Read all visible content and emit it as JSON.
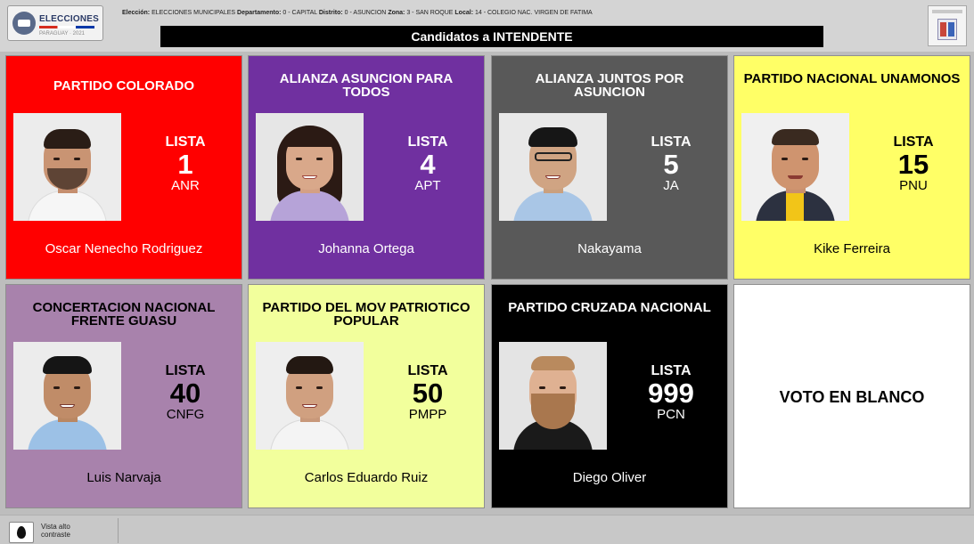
{
  "header": {
    "logo_title": "ELECCIONES",
    "logo_subtitle": "PARAGUAY · 2021",
    "info": {
      "eleccion_label": "Elección:",
      "eleccion_value": "ELECCIONES MUNICIPALES",
      "departamento_label": "Departamento:",
      "departamento_value": "0 - CAPITAL",
      "distrito_label": "Distrito:",
      "distrito_value": "0 - ASUNCION",
      "zona_label": "Zona:",
      "zona_value": "3 - SAN ROQUE",
      "local_label": "Local:",
      "local_value": "14 - COLEGIO NAC. VIRGEN DE FATIMA"
    },
    "title": "Candidatos a INTENDENTE"
  },
  "lista_word": "LISTA",
  "candidates": [
    {
      "party": "PARTIDO COLORADO",
      "lista": "1",
      "abbr": "ANR",
      "name": "Oscar Nenecho Rodriguez",
      "bg": "#ff0000",
      "fg": "#ffffff"
    },
    {
      "party": "ALIANZA ASUNCION PARA TODOS",
      "lista": "4",
      "abbr": "APT",
      "name": "Johanna Ortega",
      "bg": "#7030a0",
      "fg": "#ffffff"
    },
    {
      "party": "ALIANZA JUNTOS POR ASUNCION",
      "lista": "5",
      "abbr": "JA",
      "name": "Nakayama",
      "bg": "#595959",
      "fg": "#ffffff"
    },
    {
      "party": "PARTIDO NACIONAL UNAMONOS",
      "lista": "15",
      "abbr": "PNU",
      "name": "Kike Ferreira",
      "bg": "#ffff66",
      "fg": "#000000"
    },
    {
      "party": "CONCERTACION NACIONAL FRENTE GUASU",
      "lista": "40",
      "abbr": "CNFG",
      "name": "Luis Narvaja",
      "bg": "#a882ac",
      "fg": "#000000"
    },
    {
      "party": "PARTIDO DEL MOV PATRIOTICO POPULAR",
      "lista": "50",
      "abbr": "PMPP",
      "name": "Carlos Eduardo Ruiz",
      "bg": "#f2ff9c",
      "fg": "#000000"
    },
    {
      "party": "PARTIDO CRUZADA NACIONAL",
      "lista": "999",
      "abbr": "PCN",
      "name": "Diego Oliver",
      "bg": "#000000",
      "fg": "#ffffff"
    }
  ],
  "blank_vote": {
    "label": "VOTO EN BLANCO",
    "bg": "#ffffff"
  },
  "bottom": {
    "contrast_label": "Vista alto contraste"
  }
}
